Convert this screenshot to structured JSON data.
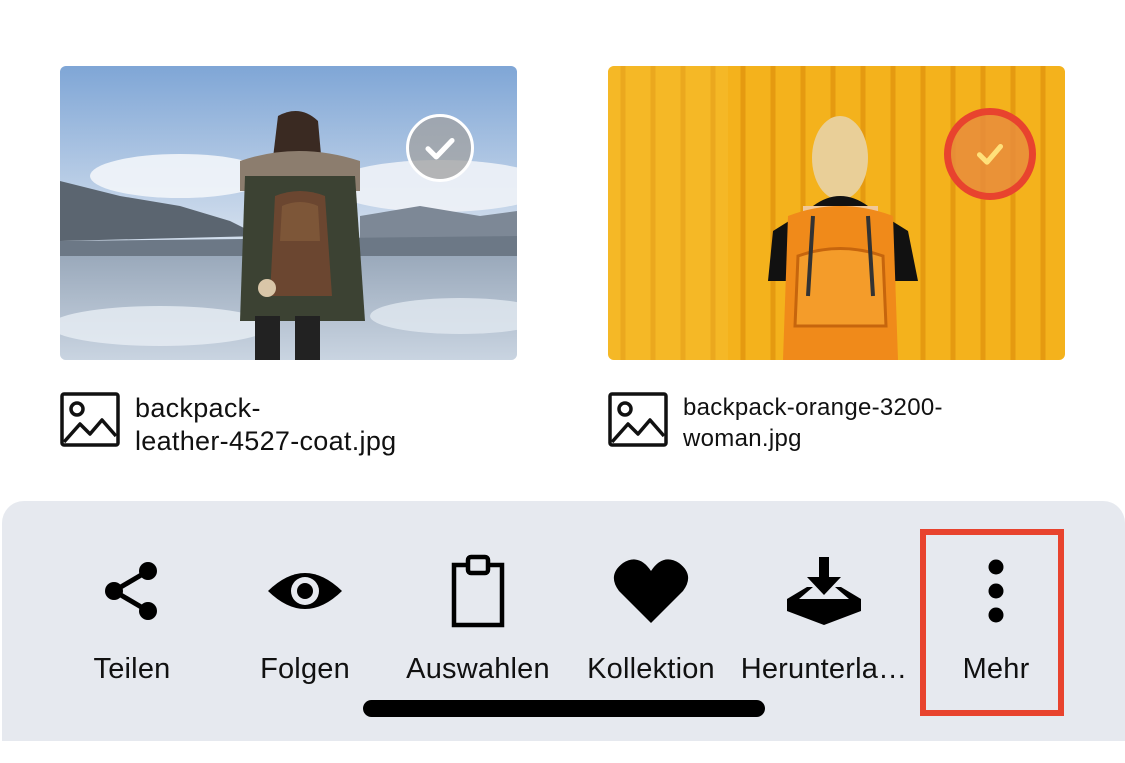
{
  "files": [
    {
      "name": "backpack-leather-4527-coat.jpg",
      "name_line1": "backpack-",
      "name_line2": "leather-4527-coat.jpg",
      "selected": false,
      "file_icon": "image-icon"
    },
    {
      "name": "backpack-orange-3200-woman.jpg",
      "name_line1": "backpack-orange-3200-",
      "name_line2": "woman.jpg",
      "selected": true,
      "file_icon": "image-icon"
    }
  ],
  "action_bar": {
    "items": [
      {
        "label": "Teilen",
        "icon": "share-icon"
      },
      {
        "label": "Folgen",
        "icon": "eye-icon"
      },
      {
        "label": "Auswahlen",
        "icon": "clipboard-icon"
      },
      {
        "label": "Kollektion",
        "icon": "heart-icon"
      },
      {
        "label": "Herunterla…",
        "icon": "download-tray-icon"
      },
      {
        "label": "Mehr",
        "icon": "more-vertical-icon"
      }
    ]
  },
  "colors": {
    "highlight": "#e8432e",
    "bar_background": "#e6e9ef",
    "selected_badge": "#e88c3c"
  }
}
